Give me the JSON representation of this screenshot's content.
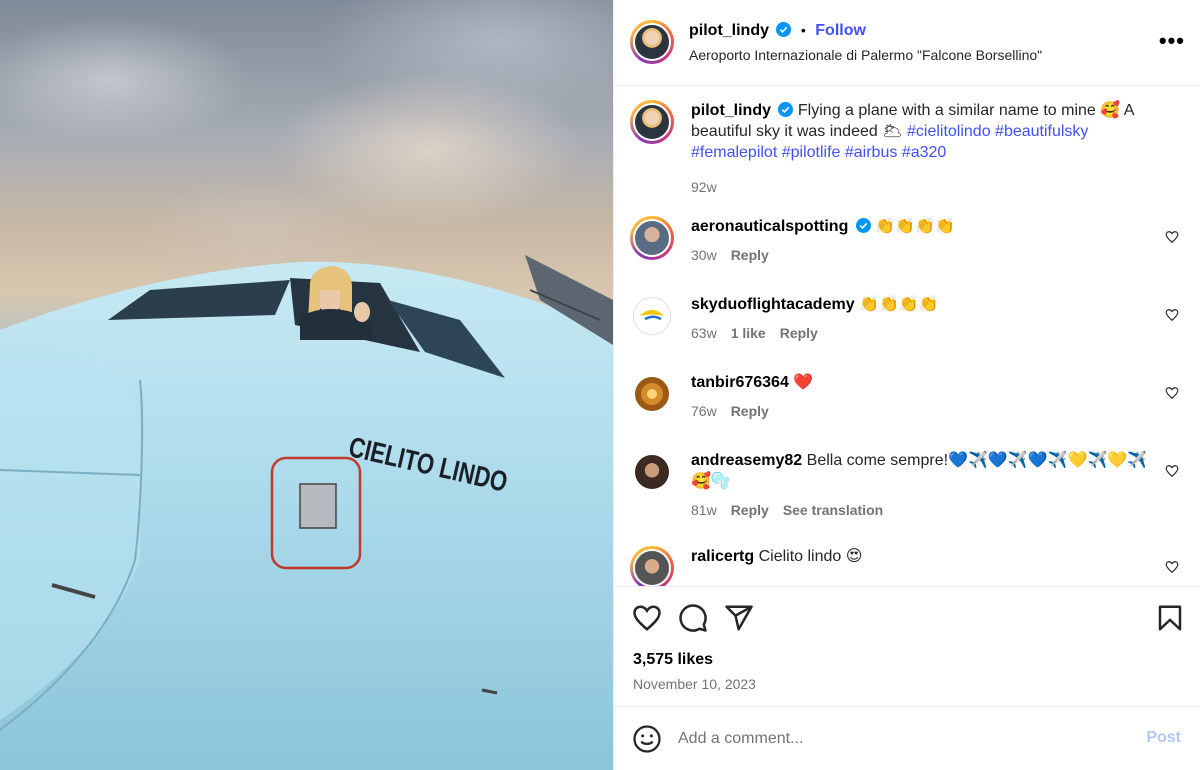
{
  "post": {
    "username": "pilot_lindy",
    "follow_label": "Follow",
    "separator": "•",
    "location": "Aeroporto Internazionale di Palermo \"Falcone Borsellino\"",
    "more_label": "•••",
    "caption_text": "Flying a plane with a similar name to mine 🥰 A beautiful sky it was indeed 🌥 ",
    "hashtags": "#cielitolindo #beautifulsky #femalepilot #pilotlife #airbus #a320",
    "caption_age": "92w",
    "aircraft_name": "CIELITO LINDO"
  },
  "comments": [
    {
      "username": "aeronauticalspotting",
      "text": "👏👏👏👏",
      "age": "30w",
      "likes": "",
      "reply": "Reply",
      "translate": ""
    },
    {
      "username": "skyduoflightacademy",
      "text": "👏👏👏👏",
      "age": "63w",
      "likes": "1 like",
      "reply": "Reply",
      "translate": ""
    },
    {
      "username": "tanbir676364",
      "text": "❤️",
      "age": "76w",
      "likes": "",
      "reply": "Reply",
      "translate": ""
    },
    {
      "username": "andreasemy82",
      "text": "Bella come sempre!💙✈️💙✈️💙✈️💛✈️💛✈️🥰🫧",
      "age": "81w",
      "likes": "",
      "reply": "Reply",
      "translate": "See translation"
    },
    {
      "username": "ralicertg",
      "text": "Cielito lindo 😍",
      "age": "",
      "likes": "",
      "reply": "",
      "translate": ""
    }
  ],
  "stats": {
    "likes": "3,575 likes",
    "date": "November 10, 2023"
  },
  "comment_box": {
    "placeholder": "Add a comment...",
    "post_label": "Post"
  },
  "colors": {
    "link_blue": "#4150f7",
    "verified_blue": "#0095f6",
    "muted": "#737373",
    "post_disabled": "#b3c7f5"
  }
}
